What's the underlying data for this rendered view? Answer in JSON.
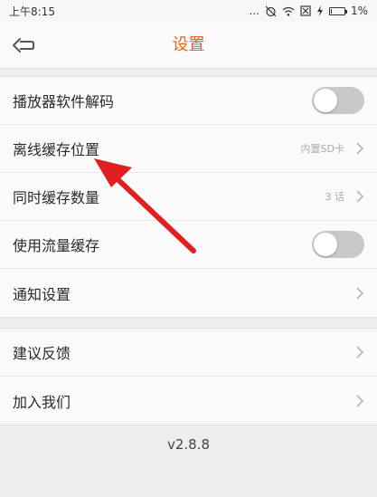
{
  "status_bar": {
    "time": "上午8:15",
    "dots": "...",
    "battery": "1%",
    "battery_level": 0.01
  },
  "header": {
    "title": "设置"
  },
  "settings": {
    "group1": [
      {
        "label": "播放器软件解码",
        "type": "toggle",
        "on": false
      },
      {
        "label": "离线缓存位置",
        "type": "link",
        "value": "内置SD卡"
      },
      {
        "label": "同时缓存数量",
        "type": "link",
        "value": "3 话"
      },
      {
        "label": "使用流量缓存",
        "type": "toggle",
        "on": false
      },
      {
        "label": "通知设置",
        "type": "link",
        "value": ""
      }
    ],
    "group2": [
      {
        "label": "建议反馈",
        "type": "link"
      },
      {
        "label": "加入我们",
        "type": "link"
      }
    ]
  },
  "version": "v2.8.8",
  "colors": {
    "accent": "#e8641b",
    "annotation": "#e02020"
  }
}
